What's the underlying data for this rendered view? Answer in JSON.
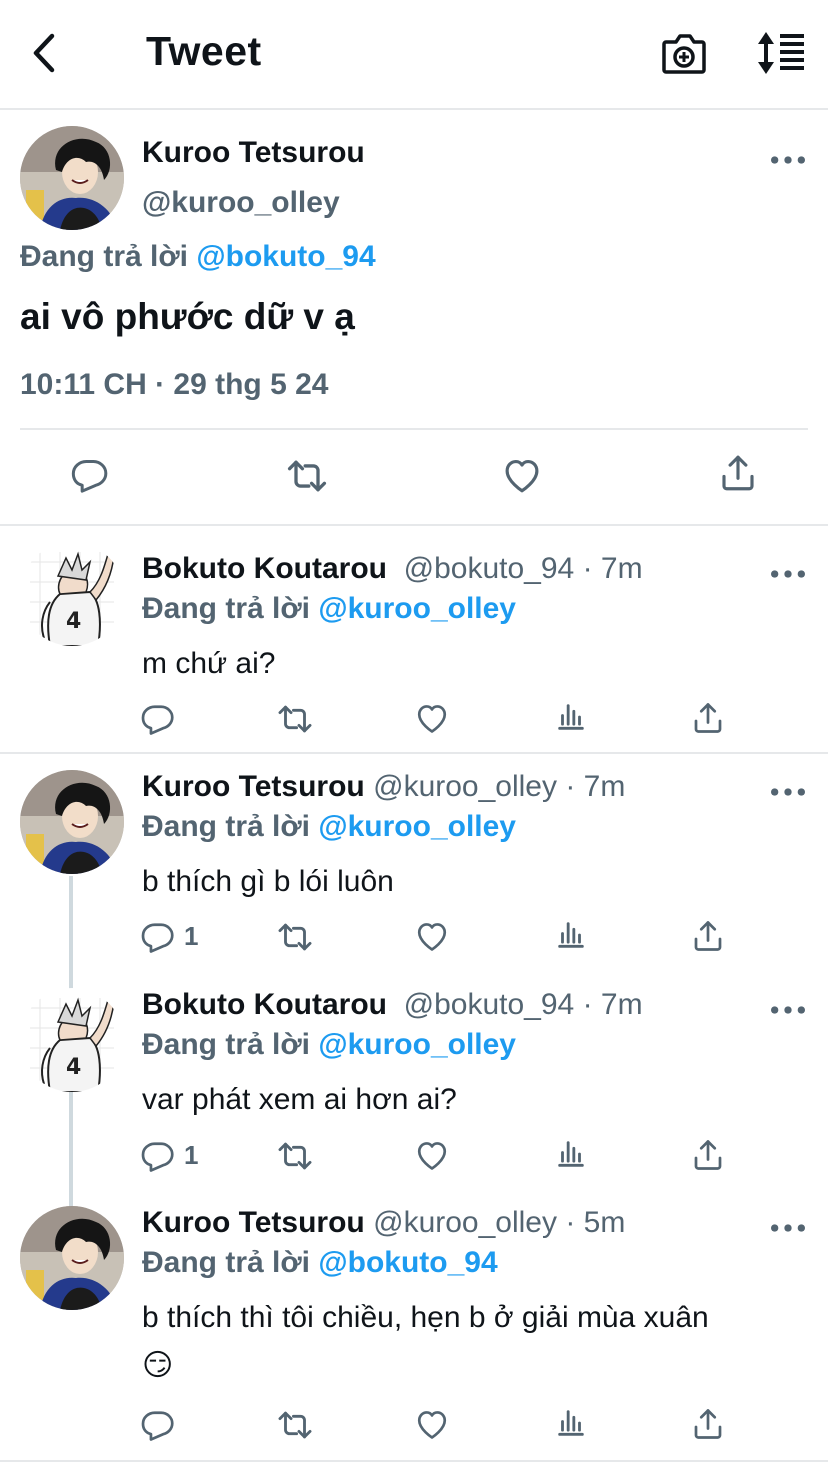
{
  "header": {
    "title": "Tweet",
    "back_icon": "chevron-left-icon",
    "camera_icon": "camera-add-icon",
    "sort_icon": "sort-list-icon"
  },
  "main_tweet": {
    "name": "Kuroo Tetsurou",
    "handle": "@kuroo_olley",
    "replying_prefix": "Đang trả lời ",
    "replying_to": "@bokuto_94",
    "text": "ai vô phước dữ v ạ",
    "meta": "10:11 CH · 29 thg 5 24"
  },
  "replies": [
    {
      "name": "Bokuto Koutarou",
      "handle": "@bokuto_94",
      "dot": " · ",
      "time": "7m",
      "replying_prefix": "Đang trả lời ",
      "replying_to": "@kuroo_olley",
      "text": "m chứ ai?",
      "reply_count": ""
    },
    {
      "name": "Kuroo Tetsurou",
      "handle": "@kuroo_olley",
      "dot": " · ",
      "time": "7m",
      "replying_prefix": "Đang trả lời ",
      "replying_to": "@kuroo_olley",
      "text": "b thích gì b lói luôn",
      "reply_count": "1"
    },
    {
      "name": "Bokuto Koutarou",
      "handle": "@bokuto_94",
      "dot": " · ",
      "time": "7m",
      "replying_prefix": "Đang trả lời ",
      "replying_to": "@kuroo_olley",
      "text": "var phát xem ai hơn ai?",
      "reply_count": "1"
    },
    {
      "name": "Kuroo Tetsurou",
      "handle": "@kuroo_olley",
      "dot": " · ",
      "time": "5m",
      "replying_prefix": "Đang trả lời ",
      "replying_to": "@bokuto_94",
      "text": "b thích thì tôi chiều, hẹn b ở giải mùa xuân",
      "emoji": "😏",
      "reply_count": ""
    }
  ],
  "colors": {
    "accent": "#1d9bf0",
    "secondary_text": "#536471",
    "divider": "#e6e8ea"
  }
}
